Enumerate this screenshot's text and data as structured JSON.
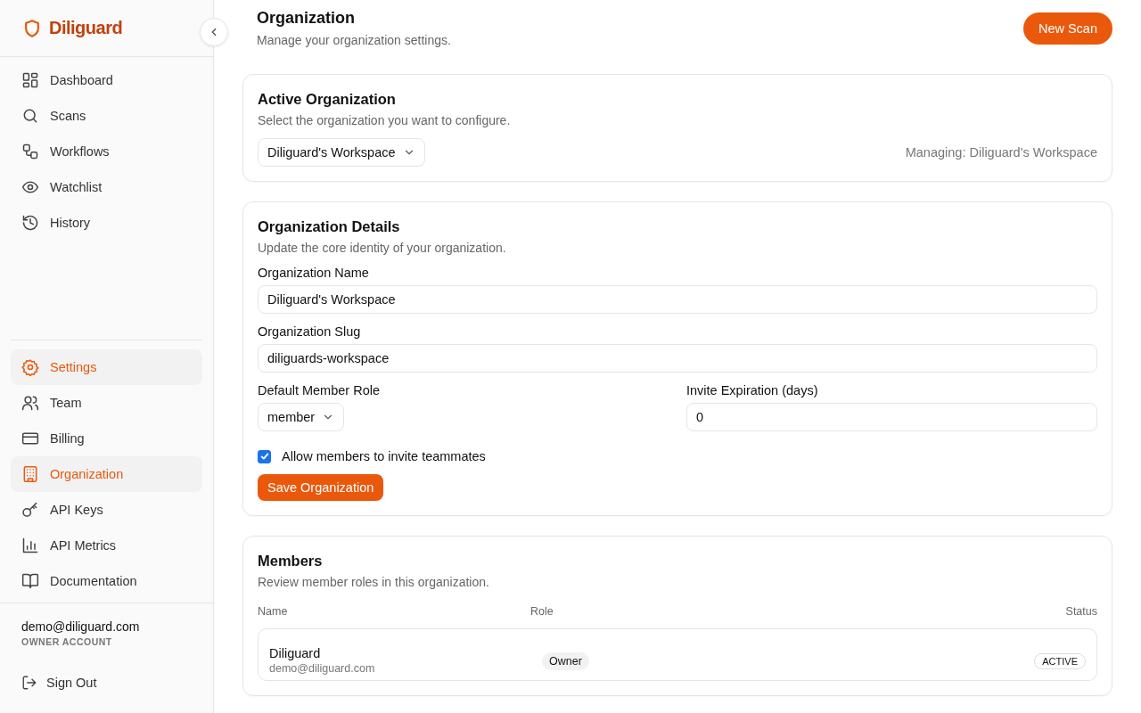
{
  "brand": {
    "name": "Diliguard"
  },
  "nav_main": [
    {
      "label": "Dashboard",
      "selected": false
    },
    {
      "label": "Scans",
      "selected": false
    },
    {
      "label": "Workflows",
      "selected": false
    },
    {
      "label": "Watchlist",
      "selected": false
    },
    {
      "label": "History",
      "selected": false
    }
  ],
  "nav_settings": [
    {
      "label": "Settings",
      "selected": true
    },
    {
      "label": "Team",
      "selected": false
    },
    {
      "label": "Billing",
      "selected": false
    },
    {
      "label": "Organization",
      "selected": true
    },
    {
      "label": "API Keys",
      "selected": false
    },
    {
      "label": "API Metrics",
      "selected": false
    },
    {
      "label": "Documentation",
      "selected": false
    }
  ],
  "account": {
    "email": "demo@diliguard.com",
    "role": "OWNER ACCOUNT",
    "sign_out": "Sign Out"
  },
  "header": {
    "title": "Organization",
    "subtitle": "Manage your organization settings.",
    "button": "New Scan"
  },
  "active_org": {
    "title": "Active Organization",
    "subtitle": "Select the organization you want to configure.",
    "select": "Diliguard's Workspace",
    "managing": "Managing: Diliguard's Workspace"
  },
  "details": {
    "title": "Organization Details",
    "subtitle": "Update the core identity of your organization.",
    "name_label": "Organization Name",
    "name_value": "Diliguard's Workspace",
    "slug_label": "Organization Slug",
    "slug_value": "diliguards-workspace",
    "role_label": "Default Member Role",
    "role_value": "member",
    "expiry_label": "Invite Expiration (days)",
    "expiry_value": "0",
    "allow_invites": {
      "label": "Allow members to invite teammates",
      "checked": true
    },
    "save": "Save Organization"
  },
  "members": {
    "title": "Members",
    "subtitle": "Review member roles in this organization.",
    "columns": [
      "Name",
      "Role",
      "Status"
    ],
    "rows": [
      {
        "name": "Diliguard",
        "email": "demo@diliguard.com",
        "role": "Owner",
        "status": "ACTIVE"
      }
    ]
  }
}
